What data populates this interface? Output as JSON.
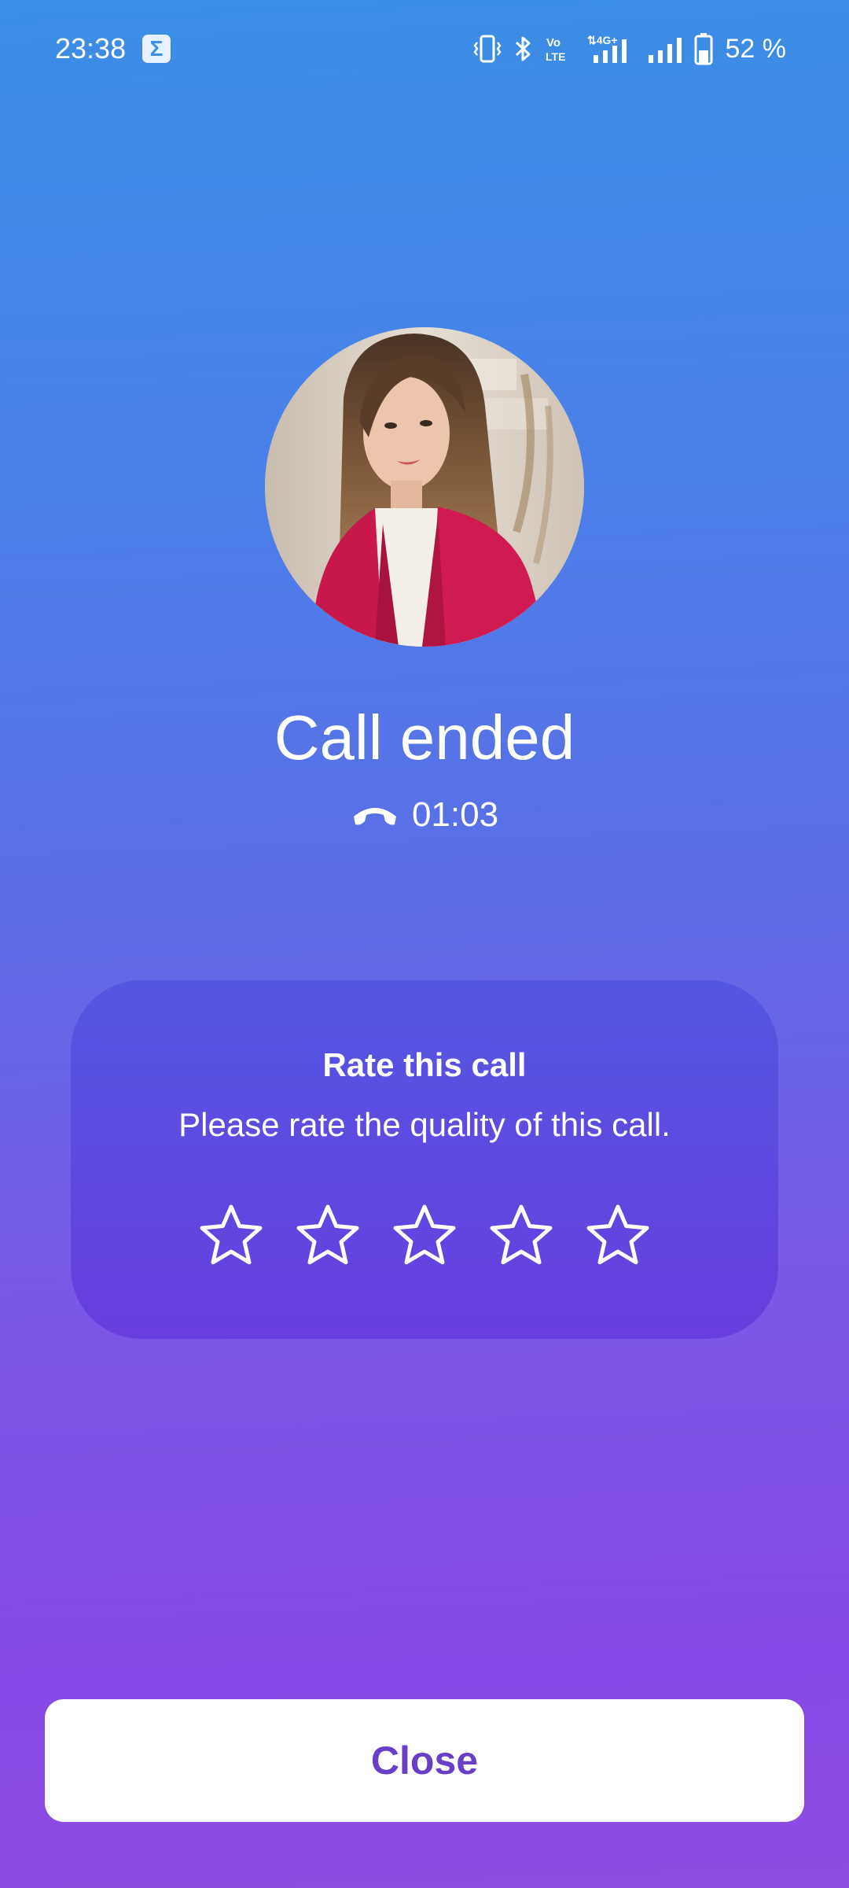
{
  "status_bar": {
    "time": "23:38",
    "notification_icon": "sigma-app-icon",
    "network_label": "4G+",
    "volte_label": "Vo LTE",
    "battery_percent": "52 %",
    "battery_level": 0.52,
    "icons": [
      "vibrate-icon",
      "bluetooth-icon",
      "volte-icon",
      "signal-4g-icon",
      "signal-icon",
      "battery-icon"
    ]
  },
  "contact": {
    "avatar_icon": "contact-photo"
  },
  "call": {
    "title": "Call ended",
    "duration_icon": "phone-hangup-icon",
    "duration": "01:03"
  },
  "rating": {
    "title": "Rate this call",
    "subtitle": "Please rate the quality of this call.",
    "max_stars": 5,
    "selected_stars": 0,
    "star_icon": "star-outline-icon"
  },
  "actions": {
    "close_label": "Close"
  },
  "colors": {
    "gradient_top": "#3a8ee6",
    "gradient_bottom": "#8e4ce0",
    "card": "#5a4ae2",
    "button_bg": "#ffffff",
    "button_text": "#6a3fc8"
  }
}
